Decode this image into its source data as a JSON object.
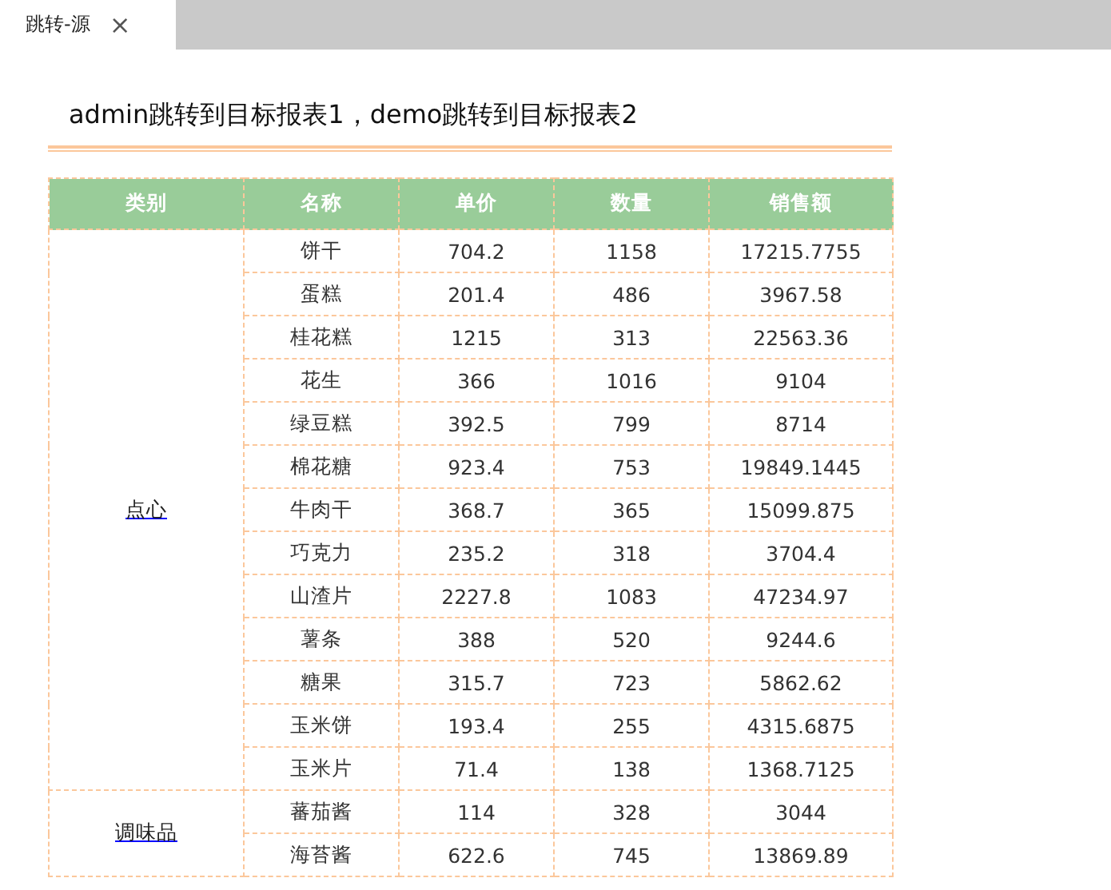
{
  "tabs": [
    {
      "label": "跳转-源",
      "selected": true,
      "close": "×"
    }
  ],
  "title": "admin跳转到目标报表1，demo跳转到目标报表2",
  "table": {
    "columns": [
      "类别",
      "名称",
      "单价",
      "数量",
      "销售额"
    ],
    "groups": [
      {
        "category": "点心",
        "rows": [
          [
            "饼干",
            "704.2",
            "1158",
            "17215.7755"
          ],
          [
            "蛋糕",
            "201.4",
            "486",
            "3967.58"
          ],
          [
            "桂花糕",
            "1215",
            "313",
            "22563.36"
          ],
          [
            "花生",
            "366",
            "1016",
            "9104"
          ],
          [
            "绿豆糕",
            "392.5",
            "799",
            "8714"
          ],
          [
            "棉花糖",
            "923.4",
            "753",
            "19849.1445"
          ],
          [
            "牛肉干",
            "368.7",
            "365",
            "15099.875"
          ],
          [
            "巧克力",
            "235.2",
            "318",
            "3704.4"
          ],
          [
            "山渣片",
            "2227.8",
            "1083",
            "47234.97"
          ],
          [
            "薯条",
            "388",
            "520",
            "9244.6"
          ],
          [
            "糖果",
            "315.7",
            "723",
            "5862.62"
          ],
          [
            "玉米饼",
            "193.4",
            "255",
            "4315.6875"
          ],
          [
            "玉米片",
            "71.4",
            "138",
            "1368.7125"
          ]
        ]
      },
      {
        "category": "调味品",
        "rows": [
          [
            "蕃茄酱",
            "114",
            "328",
            "3044"
          ],
          [
            "海苔酱",
            "622.6",
            "745",
            "13869.89"
          ]
        ]
      }
    ]
  }
}
